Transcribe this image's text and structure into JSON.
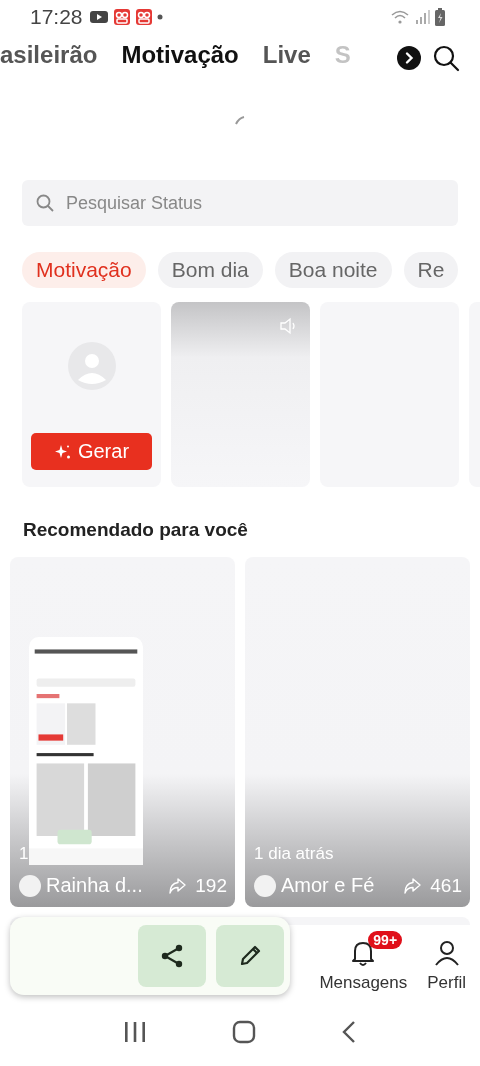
{
  "status_bar": {
    "time": "17:28"
  },
  "tabs": [
    {
      "label": "asileirão",
      "selected": false,
      "faded": false
    },
    {
      "label": "Motivação",
      "selected": true,
      "faded": false
    },
    {
      "label": "Live",
      "selected": false,
      "faded": false
    },
    {
      "label": "S",
      "selected": false,
      "faded": true
    }
  ],
  "search": {
    "placeholder": "Pesquisar Status"
  },
  "chips": [
    {
      "label": "Motivação",
      "selected": true
    },
    {
      "label": "Bom dia",
      "selected": false
    },
    {
      "label": "Boa noite",
      "selected": false
    },
    {
      "label": "Re",
      "selected": false
    }
  ],
  "status_cards": [
    {
      "kind": "create",
      "button": "Gerar"
    },
    {
      "kind": "video"
    },
    {
      "kind": "blank"
    },
    {
      "kind": "blank"
    }
  ],
  "section_title": "Recomendado para você",
  "recommended": [
    {
      "kind": "screenshot",
      "time": "1",
      "author": "Rainha d...",
      "shares": "192"
    },
    {
      "kind": "plain",
      "time": "1 dia atrás",
      "author": "Amor e Fé",
      "shares": "461"
    }
  ],
  "bottom_nav": [
    {
      "kind": "bell",
      "label": "Mensagens",
      "badge": "99+"
    },
    {
      "kind": "person",
      "label": "Perfil"
    }
  ]
}
